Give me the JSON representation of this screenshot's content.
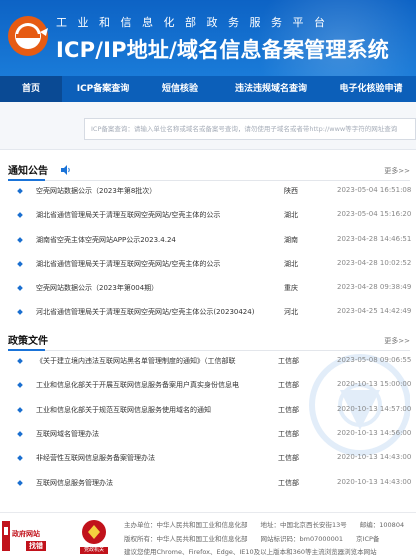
{
  "header": {
    "subtitle": "工业和信息化部政务服务平台",
    "title": "ICP/IP地址/域名信息备案管理系统",
    "colors": {
      "primary": "#0d63c5",
      "nav": "#0c5fb9",
      "nav_active": "#0a4a94",
      "logo_orange": "#e65b13"
    }
  },
  "nav": {
    "items": [
      {
        "label": "首页"
      },
      {
        "label": "ICP备案查询"
      },
      {
        "label": "短信核验"
      },
      {
        "label": "违法违规域名查询"
      },
      {
        "label": "电子化核验申请"
      }
    ]
  },
  "search": {
    "placeholder": "ICP备案查询：请输入单位名称或域名或备案号查询，请勿使用子域名或者带http://www等字符的网址查询"
  },
  "notices": {
    "title": "通知公告",
    "more": "更多>>",
    "icon": "speaker-icon",
    "rows": [
      {
        "title": "空壳网站数据公示（2023年第8批次）",
        "region": "陕西",
        "date": "2023-05-04 16:51:08"
      },
      {
        "title": "湖北省通信管理局关于清理互联网空壳网站/空壳主体的公示",
        "region": "湖北",
        "date": "2023-05-04 15:16:20"
      },
      {
        "title": "湖南省空壳主体空壳网站APP公示2023.4.24",
        "region": "湖南",
        "date": "2023-04-28 14:46:51"
      },
      {
        "title": "湖北省通信管理局关于清理互联网空壳网站/空壳主体的公示",
        "region": "湖北",
        "date": "2023-04-28 10:02:52"
      },
      {
        "title": "空壳网站数据公示（2023年第004期）",
        "region": "重庆",
        "date": "2023-04-28 09:38:49"
      },
      {
        "title": "河北省通信管理局关于清理互联网空壳网站/空壳主体公示(20230424)",
        "region": "河北",
        "date": "2023-04-25 14:42:49"
      }
    ]
  },
  "policies": {
    "title": "政策文件",
    "more": "更多>>",
    "rows": [
      {
        "title": "《关于建立境内违法互联网站黑名单管理制度的通知》（工信部联",
        "region": "工信部",
        "date": "2023-05-08 09:06:55"
      },
      {
        "title": "工业和信息化部关于开展互联网信息服务备案用户真实身份信息电",
        "region": "工信部",
        "date": "2020-10-13 15:00:00"
      },
      {
        "title": "工业和信息化部关于规范互联网信息服务使用域名的通知",
        "region": "工信部",
        "date": "2020-10-13 14:57:00"
      },
      {
        "title": "互联网域名管理办法",
        "region": "工信部",
        "date": "2020-10-13 14:56:00"
      },
      {
        "title": "非经营性互联网信息服务备案管理办法",
        "region": "工信部",
        "date": "2020-10-13 14:43:00"
      },
      {
        "title": "互联网信息服务管理办法",
        "region": "工信部",
        "date": "2020-10-13 14:43:00"
      }
    ]
  },
  "footer": {
    "gov_badge_line1": "政府网站",
    "gov_badge_line2": "找错",
    "party_badge_text": "党政机关",
    "line1": "主办单位：中华人民共和国工业和信息化部　　地址：中国北京西长安街13号　　邮编：100804",
    "line2": "版权所有：中华人民共和国工业和信息化部　　网站标识码：bm07000001　　京ICP备",
    "line3": "建议您使用Chrome、Firefox、Edge、IE10及以上版本和360等主流浏览器浏览本网站"
  }
}
